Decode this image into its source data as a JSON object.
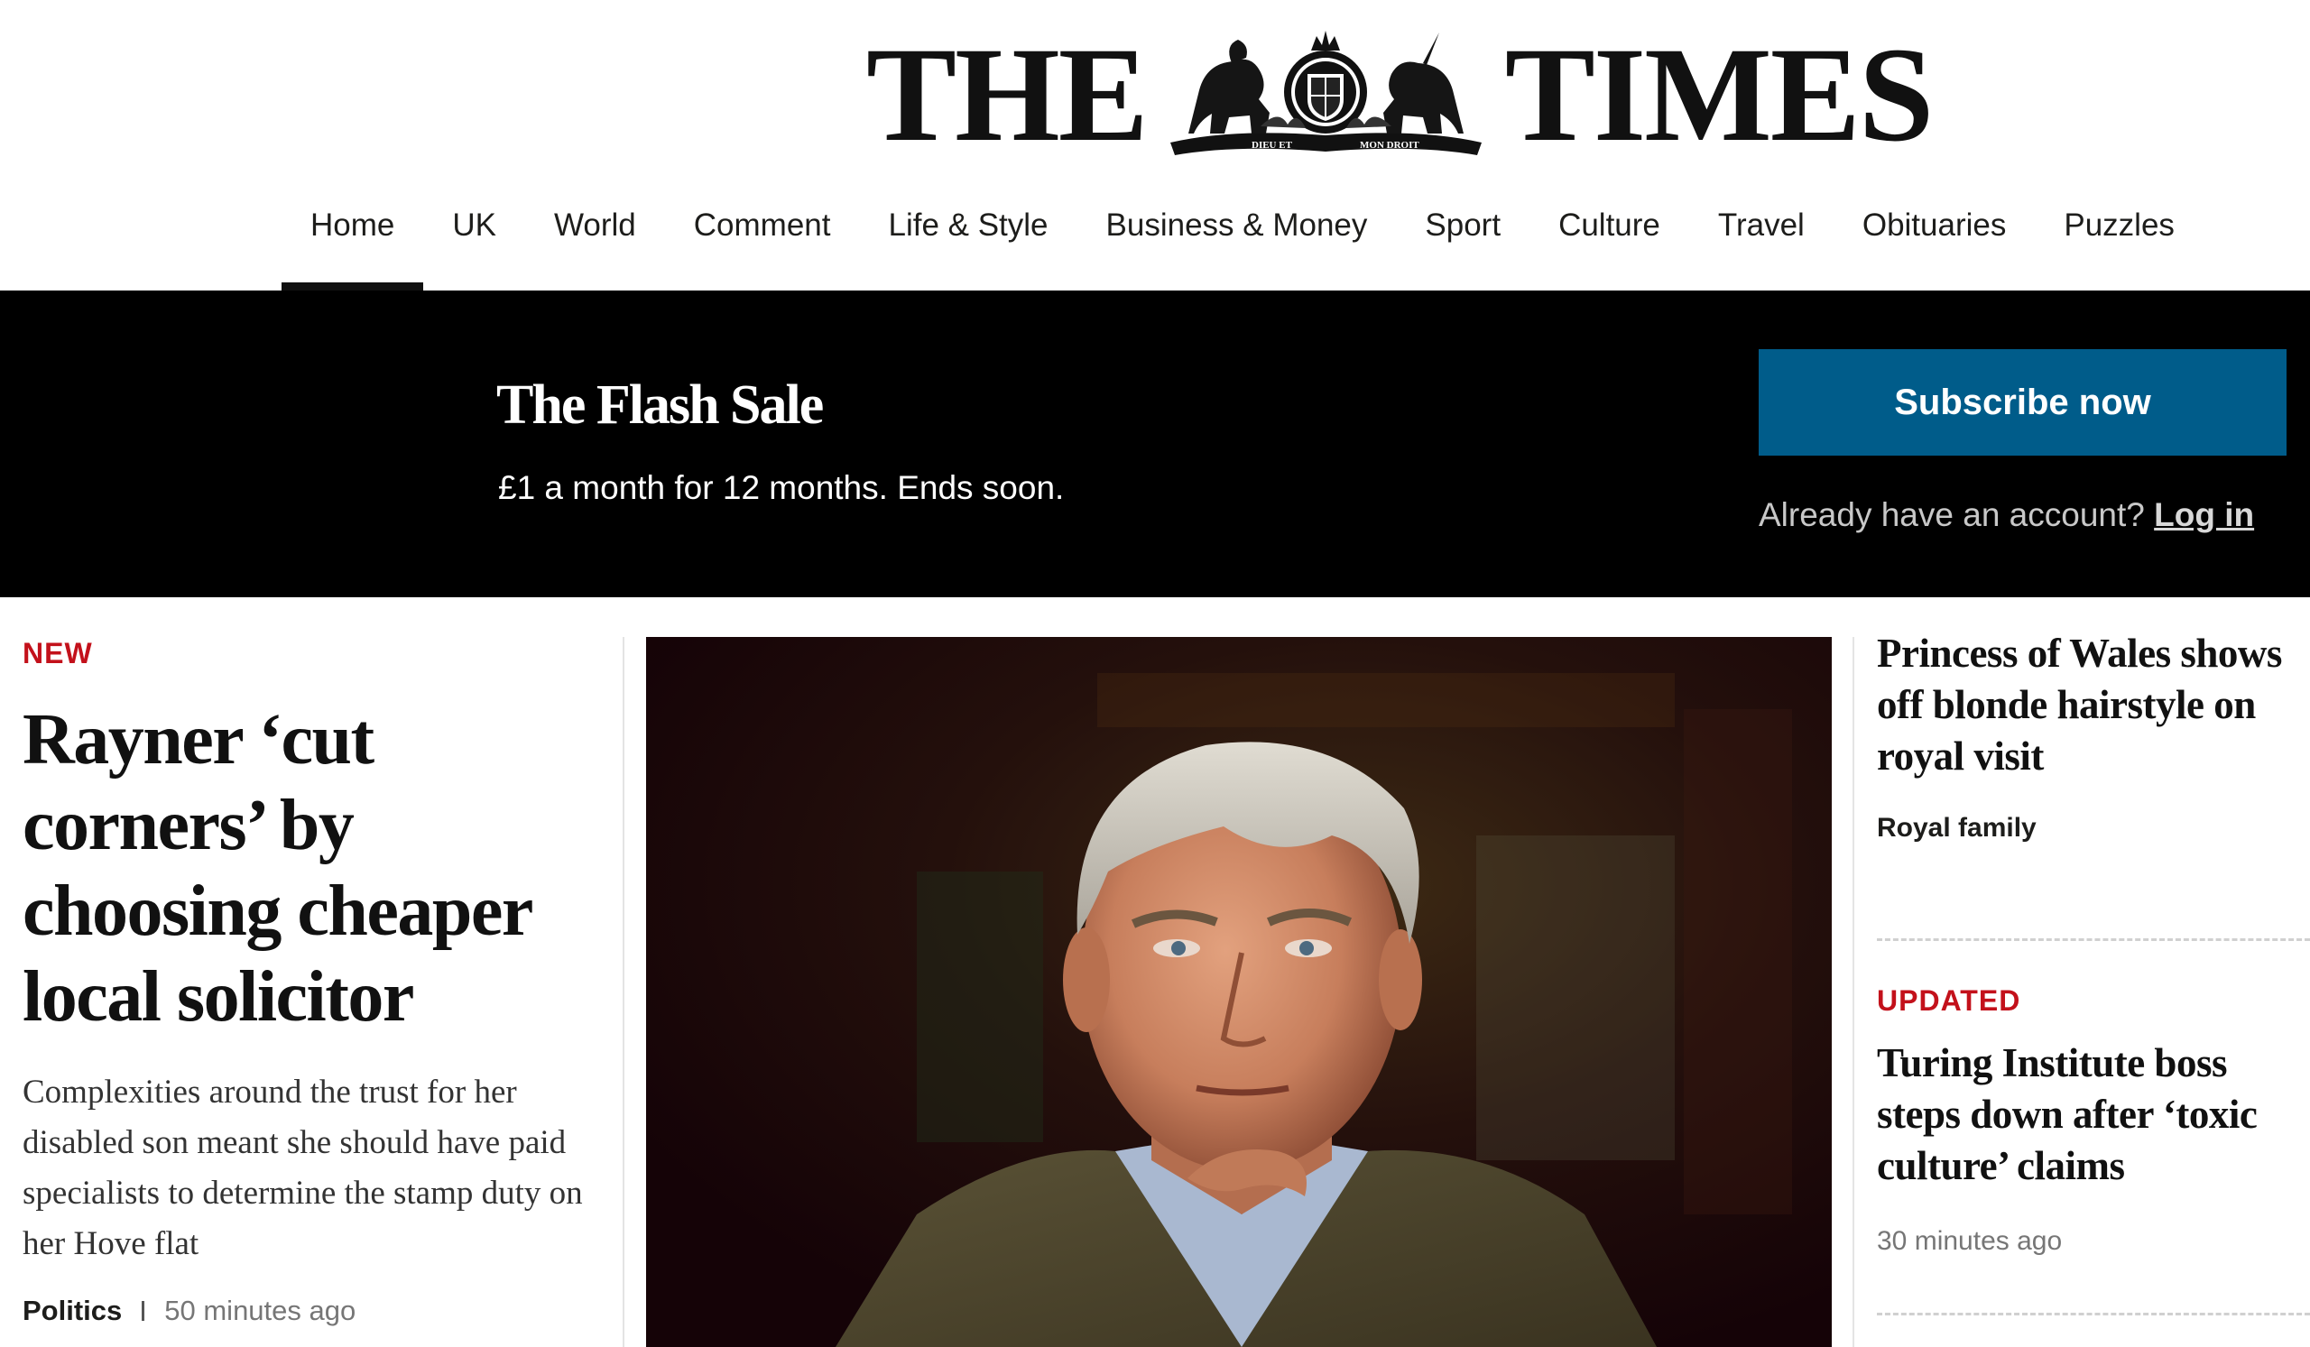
{
  "masthead": {
    "logo_left": "THE",
    "logo_right": "TIMES",
    "crest_motto_left": "DIEU ET",
    "crest_motto_right": "MON DROIT"
  },
  "nav": {
    "active": "Home",
    "items": [
      "Home",
      "UK",
      "World",
      "Comment",
      "Life & Style",
      "Business & Money",
      "Sport",
      "Culture",
      "Travel",
      "Obituaries",
      "Puzzles"
    ]
  },
  "promo": {
    "title": "The Flash Sale",
    "subtitle": "£1 a month for 12 months. Ends soon.",
    "subscribe_label": "Subscribe now",
    "account_prompt": "Already have an account?",
    "login_label": "Log in"
  },
  "lead_story": {
    "label": "NEW",
    "headline": "Rayner ‘cut corners’ by choosing cheaper local solicitor",
    "standfirst": "Complexities around the trust for her disabled son meant she should have paid specialists to determine the stamp duty on her Hove flat",
    "tag": "Politics",
    "time": "50 minutes ago"
  },
  "side_stories": [
    {
      "headline": "Princess of Wales shows off blonde hairstyle on royal visit",
      "tag": "Royal family"
    },
    {
      "label": "UPDATED",
      "headline": "Turing Institute boss steps down after ‘toxic culture’ claims",
      "time": "30 minutes ago"
    }
  ],
  "colors": {
    "promo_bg": "#000000",
    "subscribe_bg": "#005c8a",
    "label_red": "#c3111b",
    "text": "#1d1d1b"
  }
}
